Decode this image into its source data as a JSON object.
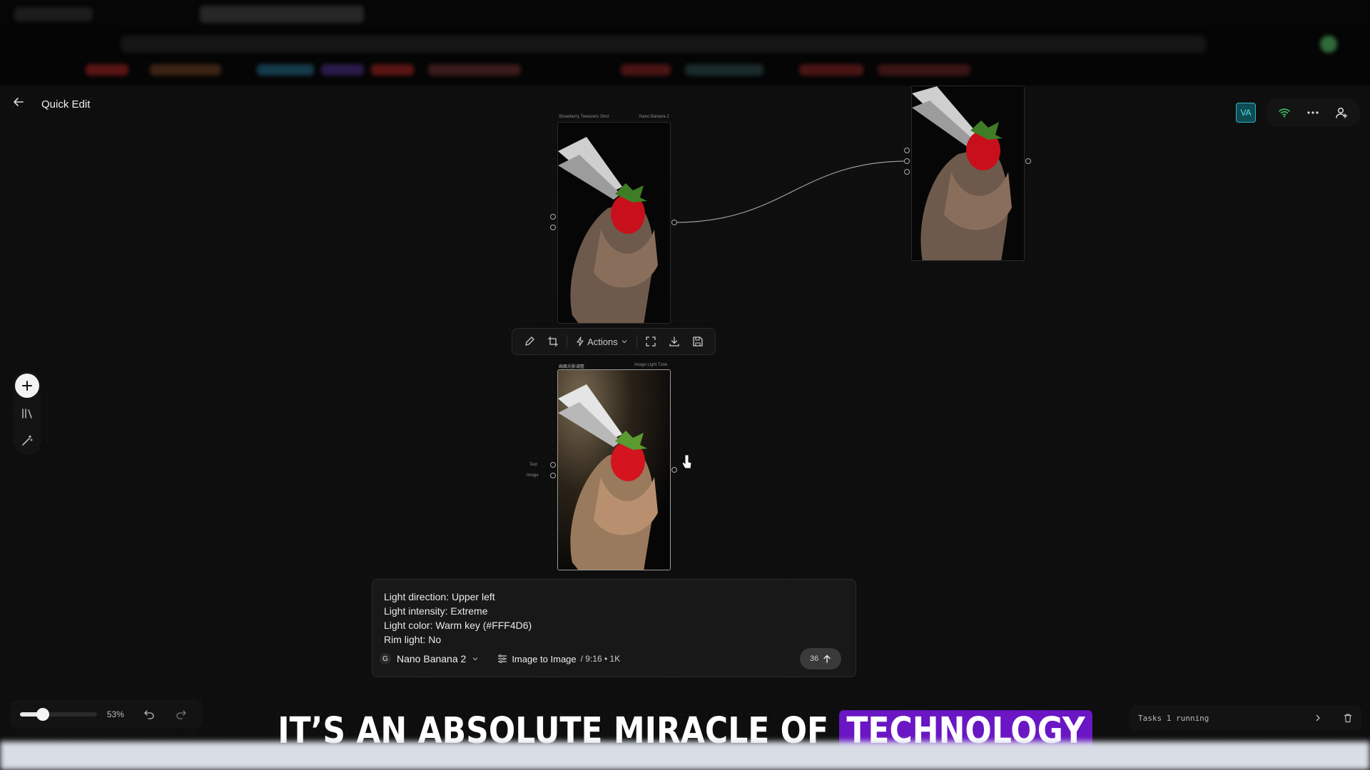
{
  "app": {
    "title": "Quick Edit"
  },
  "topbar": {
    "user_badge": "VA",
    "icons": [
      "wifi-icon",
      "more-icon",
      "add-user-icon"
    ]
  },
  "left_toolbar": {
    "icons": [
      "plus-icon",
      "library-icon",
      "magic-wand-icon"
    ]
  },
  "nodes": {
    "source": {
      "header_title": "Strawberry Tweezers Shot",
      "header_model": "Nano Banana 2"
    },
    "edited": {
      "header_title": "画面光影调整",
      "header_model": "Image Light Tune",
      "input_text": "Text",
      "input_image": "Image"
    }
  },
  "node_toolbar": {
    "actions_label": "Actions"
  },
  "prompt": {
    "lines": [
      "Light direction: Upper left",
      "Light intensity: Extreme",
      "Light color: Warm key (#FFF4D6)",
      "Rim light: No"
    ],
    "model": "Nano Banana 2",
    "mode": "Image to Image",
    "meta": "/ 9:16 • 1K",
    "credits": "36"
  },
  "zoom": {
    "level_text": "53%",
    "level": 0.53
  },
  "tasks": {
    "label": "Tasks 1 running"
  },
  "caption": {
    "text": "IT’S AN ABSOLUTE MIRACLE OF",
    "highlight": "TECHNOLOGY"
  },
  "colors": {
    "accent_badge": "#2fb4c2",
    "caption_highlight": "#6a16c4",
    "strawberry": "#c8101c"
  }
}
